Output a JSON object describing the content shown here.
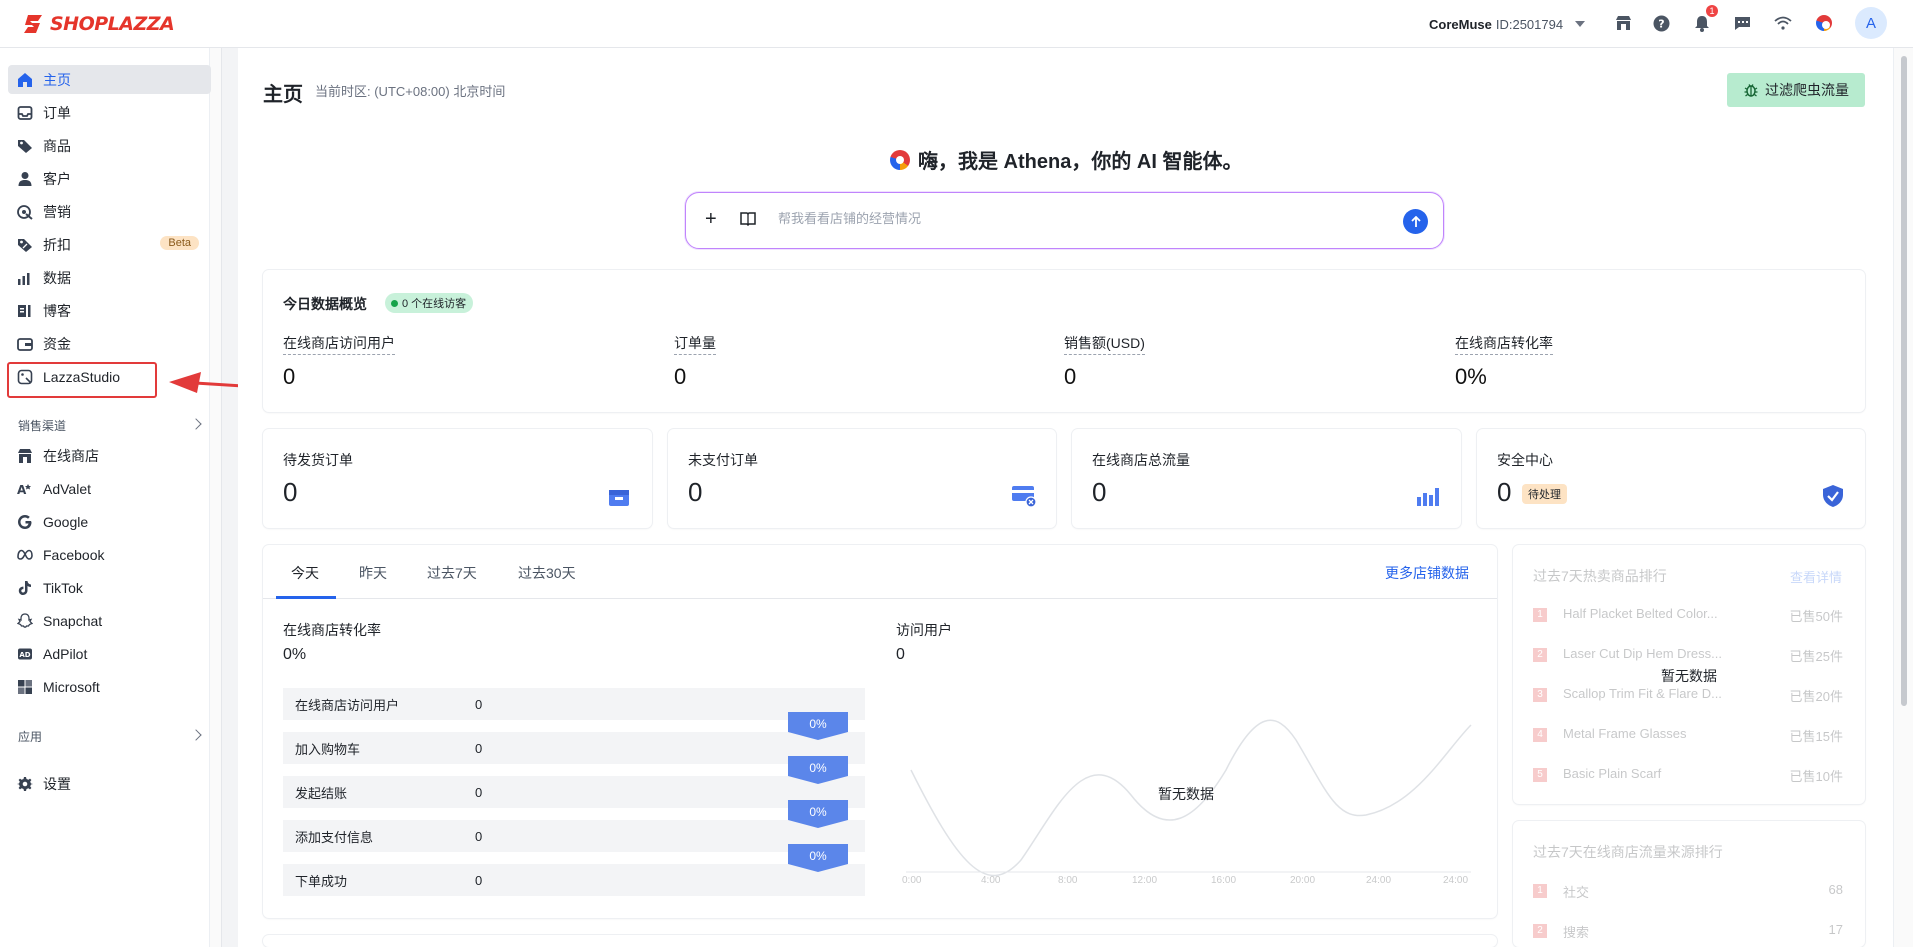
{
  "brand": {
    "logo_text": "SHOPLAZZA"
  },
  "topbar": {
    "store_name": "CoreMuse",
    "store_id": "ID:2501794",
    "notif_count": "1",
    "avatar_letter": "A"
  },
  "sidebar": {
    "items": [
      {
        "label": "主页"
      },
      {
        "label": "订单"
      },
      {
        "label": "商品"
      },
      {
        "label": "客户"
      },
      {
        "label": "营销"
      },
      {
        "label": "折扣"
      },
      {
        "label": "数据"
      },
      {
        "label": "博客"
      },
      {
        "label": "资金"
      },
      {
        "label": "LazzaStudio"
      }
    ],
    "beta_label": "Beta",
    "sales_channels_title": "销售渠道",
    "channels": [
      {
        "label": "在线商店"
      },
      {
        "label": "AdValet"
      },
      {
        "label": "Google"
      },
      {
        "label": "Facebook"
      },
      {
        "label": "TikTok"
      },
      {
        "label": "Snapchat"
      },
      {
        "label": "AdPilot"
      },
      {
        "label": "Microsoft"
      }
    ],
    "apps_title": "应用",
    "settings_label": "设置"
  },
  "header": {
    "title": "主页",
    "timezone": "当前时区: (UTC+08:00) 北京时间",
    "filter_button": "过滤爬虫流量"
  },
  "athena": {
    "greeting": "嗨，我是 Athena，你的 AI 智能体。",
    "placeholder": "帮我看看店铺的经营情况"
  },
  "overview": {
    "title": "今日数据概览",
    "online_badge": "0 个在线访客",
    "metrics": [
      {
        "label": "在线商店访问用户",
        "value": "0"
      },
      {
        "label": "订单量",
        "value": "0"
      },
      {
        "label": "销售额(USD)",
        "value": "0"
      },
      {
        "label": "在线商店转化率",
        "value": "0%"
      }
    ]
  },
  "kpis": [
    {
      "label": "待发货订单",
      "value": "0"
    },
    {
      "label": "未支付订单",
      "value": "0"
    },
    {
      "label": "在线商店总流量",
      "value": "0"
    },
    {
      "label": "安全中心",
      "value": "0",
      "badge": "待处理"
    }
  ],
  "tabs": {
    "items": [
      "今天",
      "昨天",
      "过去7天",
      "过去30天"
    ],
    "active": "今天",
    "more_link": "更多店铺数据"
  },
  "conversion": {
    "title": "在线商店转化率",
    "value": "0%",
    "funnel": [
      {
        "label": "在线商店访问用户",
        "value": "0"
      },
      {
        "label": "加入购物车",
        "value": "0"
      },
      {
        "label": "发起结账",
        "value": "0"
      },
      {
        "label": "添加支付信息",
        "value": "0"
      },
      {
        "label": "下单成功",
        "value": "0"
      }
    ],
    "step_rates": [
      "0%",
      "0%",
      "0%",
      "0%"
    ]
  },
  "visitors": {
    "title": "访问用户",
    "value": "0",
    "no_data": "暂无数据",
    "x_ticks": [
      "0:00",
      "4:00",
      "8:00",
      "12:00",
      "16:00",
      "20:00",
      "24:00"
    ]
  },
  "hot_products": {
    "title": "过去7天热卖商品排行",
    "link": "查看详情",
    "no_data": "暂无数据",
    "items": [
      {
        "rank": "1",
        "name": "Half Placket Belted Color...",
        "sold": "已售50件"
      },
      {
        "rank": "2",
        "name": "Laser Cut Dip Hem Dress...",
        "sold": "已售25件"
      },
      {
        "rank": "3",
        "name": "Scallop Trim Fit & Flare D...",
        "sold": "已售20件"
      },
      {
        "rank": "4",
        "name": "Metal Frame Glasses",
        "sold": "已售15件"
      },
      {
        "rank": "5",
        "name": "Basic Plain Scarf",
        "sold": "已售10件"
      }
    ]
  },
  "traffic_sources": {
    "title": "过去7天在线商店流量来源排行",
    "items": [
      {
        "rank": "1",
        "name": "社交",
        "value": "68"
      },
      {
        "rank": "2",
        "name": "搜索",
        "value": "17"
      }
    ]
  },
  "colors": {
    "accent": "#2563eb",
    "brand_red": "#e5352b",
    "highlight": "#e23a3a",
    "filter_bg": "#b7ebcf"
  }
}
